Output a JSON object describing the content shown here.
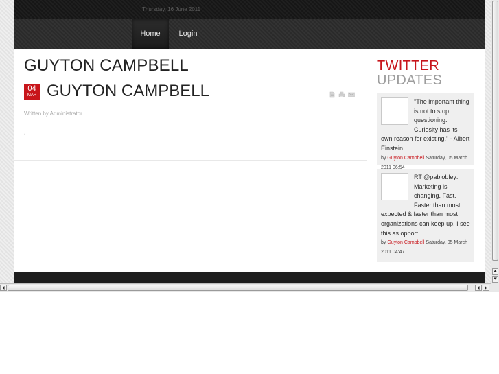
{
  "header": {
    "date": "Thursday, 16 June 2011"
  },
  "nav": {
    "items": [
      {
        "label": "Home",
        "active": true
      },
      {
        "label": "Login",
        "active": false
      }
    ]
  },
  "article": {
    "page_heading": "GUYTON CAMPBELL",
    "badge_day": "04",
    "badge_month": "MAR",
    "title": "GUYTON CAMPBELL",
    "meta": "Written by Administrator.",
    "body": ",",
    "action_icons": [
      "pdf-icon",
      "print-icon",
      "email-icon"
    ]
  },
  "sidebar": {
    "title_line1": "TWITTER",
    "title_line2": "UPDATES",
    "tweets": [
      {
        "text": "\"The important thing is not to stop questioning. Curiosity has its own reason for existing.\" - Albert Einstein",
        "by": "by",
        "author": "Guyton Campbell",
        "time": "Saturday, 05 March 2011 06:54"
      },
      {
        "text": "RT @pablobley: Marketing is changing. Fast. Faster than most expected & faster than most organizations can keep up. I see this as opport ...",
        "by": "by",
        "author": "Guyton Campbell",
        "time": "Saturday, 05 March 2011 04:47"
      }
    ]
  },
  "colors": {
    "accent": "#c8151b",
    "dark_bar": "#1e1e1e",
    "muted_title": "#9d9d9d"
  }
}
